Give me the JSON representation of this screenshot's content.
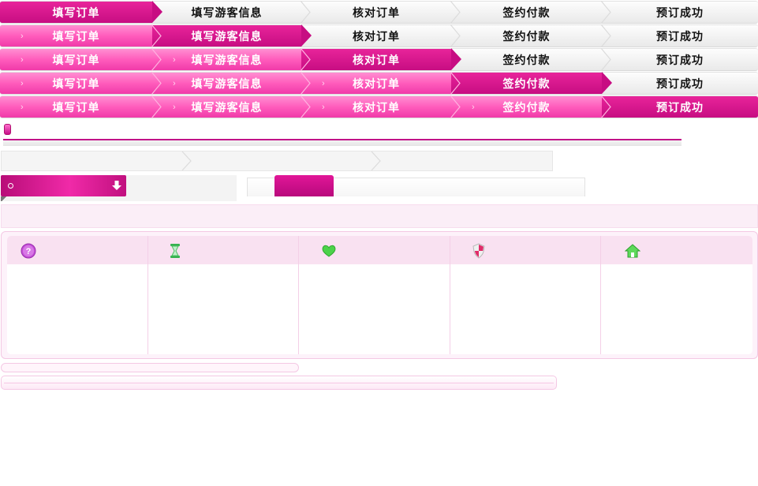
{
  "steps": [
    "填写订单",
    "填写游客信息",
    "核对订单",
    "签约付款",
    "预订成功"
  ],
  "step_rows": [
    {
      "active": 0
    },
    {
      "active": 1
    },
    {
      "active": 2
    },
    {
      "active": 3
    },
    {
      "active": 4
    }
  ],
  "colors": {
    "accent": "#c70d82",
    "done": "#ff5cbc",
    "idle": "#eeeeee"
  },
  "icons": [
    "help-icon",
    "hourglass-icon",
    "heart-icon",
    "shield-icon",
    "home-icon"
  ]
}
